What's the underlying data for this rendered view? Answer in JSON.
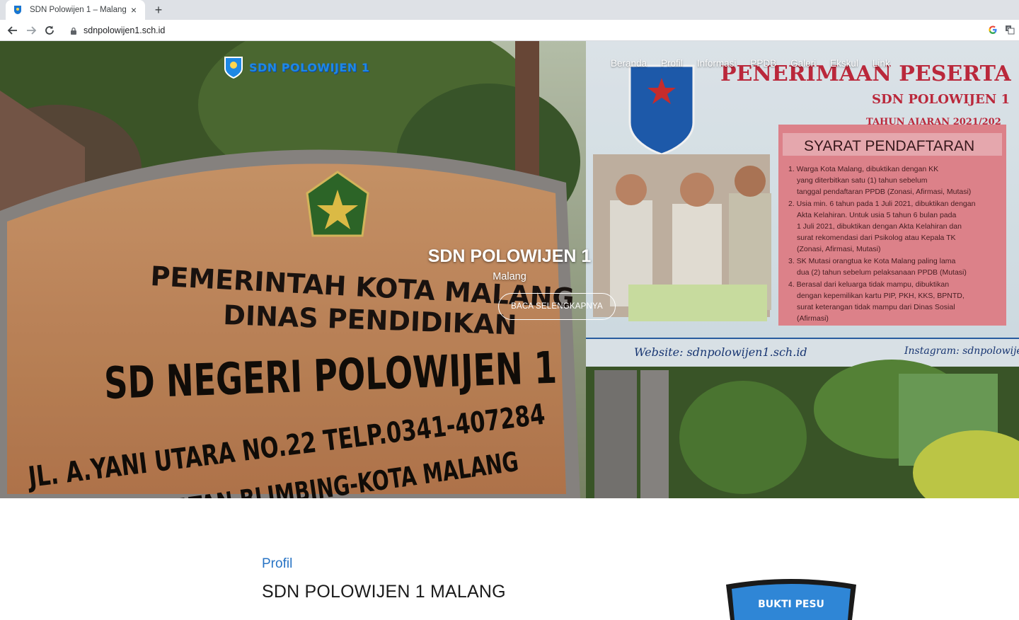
{
  "browser": {
    "tab_title": "SDN Polowijen 1 – Malang",
    "tab_close": "×",
    "new_tab": "+",
    "url": "sdnpolowijen1.sch.id",
    "icons": [
      "back-arrow-icon",
      "forward-arrow-icon",
      "reload-icon",
      "lock-icon",
      "google-icon",
      "translate-icon"
    ]
  },
  "site": {
    "logo_text": "SDN POLOWIJEN 1",
    "nav": [
      "Beranda",
      "Profil",
      "Informasi",
      "PPDB",
      "Galeri",
      "Ekskul",
      "Link"
    ]
  },
  "hero": {
    "title": "SDN POLOWIJEN 1",
    "subtitle": "Malang",
    "button": "BACA SELENGKAPNYA",
    "sign_lines": [
      "PEMERINTAH KOTA MALANG",
      "DINAS PENDIDIKAN",
      "SD NEGERI POLOWIJEN 1",
      "JL. A.YANI UTARA NO.22 TELP.0341-407284",
      "KECAMATAN BLIMBING-KOTA MALANG"
    ],
    "banner": {
      "heading": "PENERIMAAN PESERTA",
      "school": "SDN POLOWIJEN 1",
      "year": "TAHUN AJARAN 2021/202",
      "syarat_title": "SYARAT PENDAFTARAN",
      "syarat_items": [
        "1. Warga Kota Malang, dibuktikan dengan KK",
        "yang diterbitkan satu (1) tahun sebelum",
        "tanggal pendaftaran PPDB (Zonasi, Afirmasi, Mutasi)",
        "2. Usia min. 6 tahun pada 1 Juli 2021, dibuktikan dengan",
        "Akta Kelahiran. Untuk usia 5 tahun 6 bulan pada",
        "1 Juli 2021, dibuktikan dengan Akta Kelahiran dan",
        "surat rekomendasi dari Psikolog atau Kepala TK",
        "(Zonasi, Afirmasi, Mutasi)",
        "3. SK Mutasi orangtua ke Kota Malang paling lama",
        "dua (2) tahun sebelum pelaksanaan PPDB (Mutasi)",
        "4. Berasal dari keluarga tidak mampu, dibuktikan",
        "dengan kepemilikan kartu PIP, PKH, KKS, BPNTD,",
        "surat keterangan tidak mampu dari Dinas Sosial",
        "(Afirmasi)"
      ],
      "website": "Website: sdnpolowijen1.sch.id",
      "instagram": "Instagram: sdnpolowije"
    }
  },
  "content": {
    "section_label": "Profil",
    "section_title": "SDN POLOWIJEN 1 MALANG",
    "crest_text": "BUKTI PESU"
  },
  "colors": {
    "accent_blue": "#2874c5",
    "logo_blue": "#1e88e5",
    "sign_orange": "#c9895a",
    "banner_red": "#e0707a"
  }
}
